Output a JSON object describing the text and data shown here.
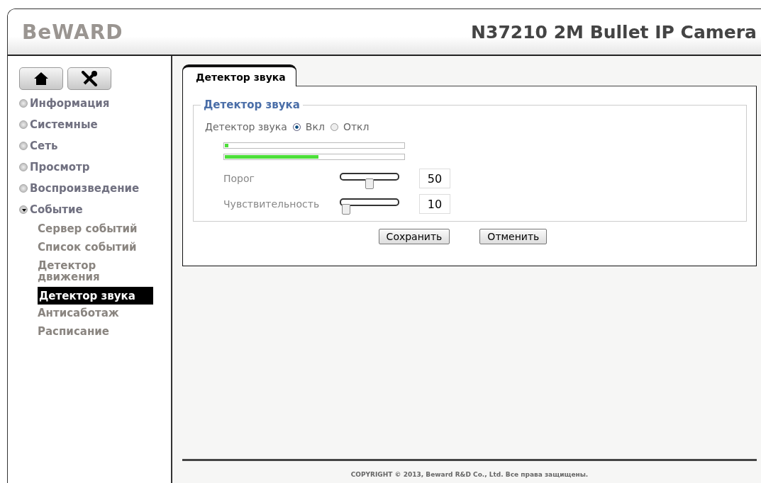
{
  "header": {
    "logo": "BeWARD",
    "title": "N37210 2M Bullet IP Camera"
  },
  "sidebar": {
    "items": [
      {
        "label": "Информация",
        "expanded": false
      },
      {
        "label": "Системные",
        "expanded": false
      },
      {
        "label": "Сеть",
        "expanded": false
      },
      {
        "label": "Просмотр",
        "expanded": false
      },
      {
        "label": "Воспроизведение",
        "expanded": false
      },
      {
        "label": "Событие",
        "expanded": true,
        "children": [
          {
            "label": "Сервер событий",
            "selected": false
          },
          {
            "label": "Список событий",
            "selected": false
          },
          {
            "label": "Детектор движения",
            "selected": false
          },
          {
            "label": "Детектор звука",
            "selected": true
          },
          {
            "label": "Антисаботаж",
            "selected": false
          },
          {
            "label": "Расписание",
            "selected": false
          }
        ]
      }
    ]
  },
  "tabs": [
    {
      "label": "Детектор звука",
      "selected": true
    }
  ],
  "group": {
    "legend": "Детектор звука",
    "label": "Детектор звука",
    "options": [
      {
        "label": "Вкл",
        "selected": true
      },
      {
        "label": "Откл",
        "selected": false
      }
    ],
    "meters": [
      {
        "level": 0.02
      },
      {
        "level": 0.52
      }
    ],
    "sliders": [
      {
        "label": "Порог",
        "level": 0.5,
        "value": "50"
      },
      {
        "label": "Чувствительность",
        "level": 0.04,
        "value": "10"
      }
    ]
  },
  "buttons": [
    "Сохранить",
    "Отменить"
  ],
  "footer": "COPYRIGHT © 2013, Beward R&D Co., Ltd. Все права защищены."
}
